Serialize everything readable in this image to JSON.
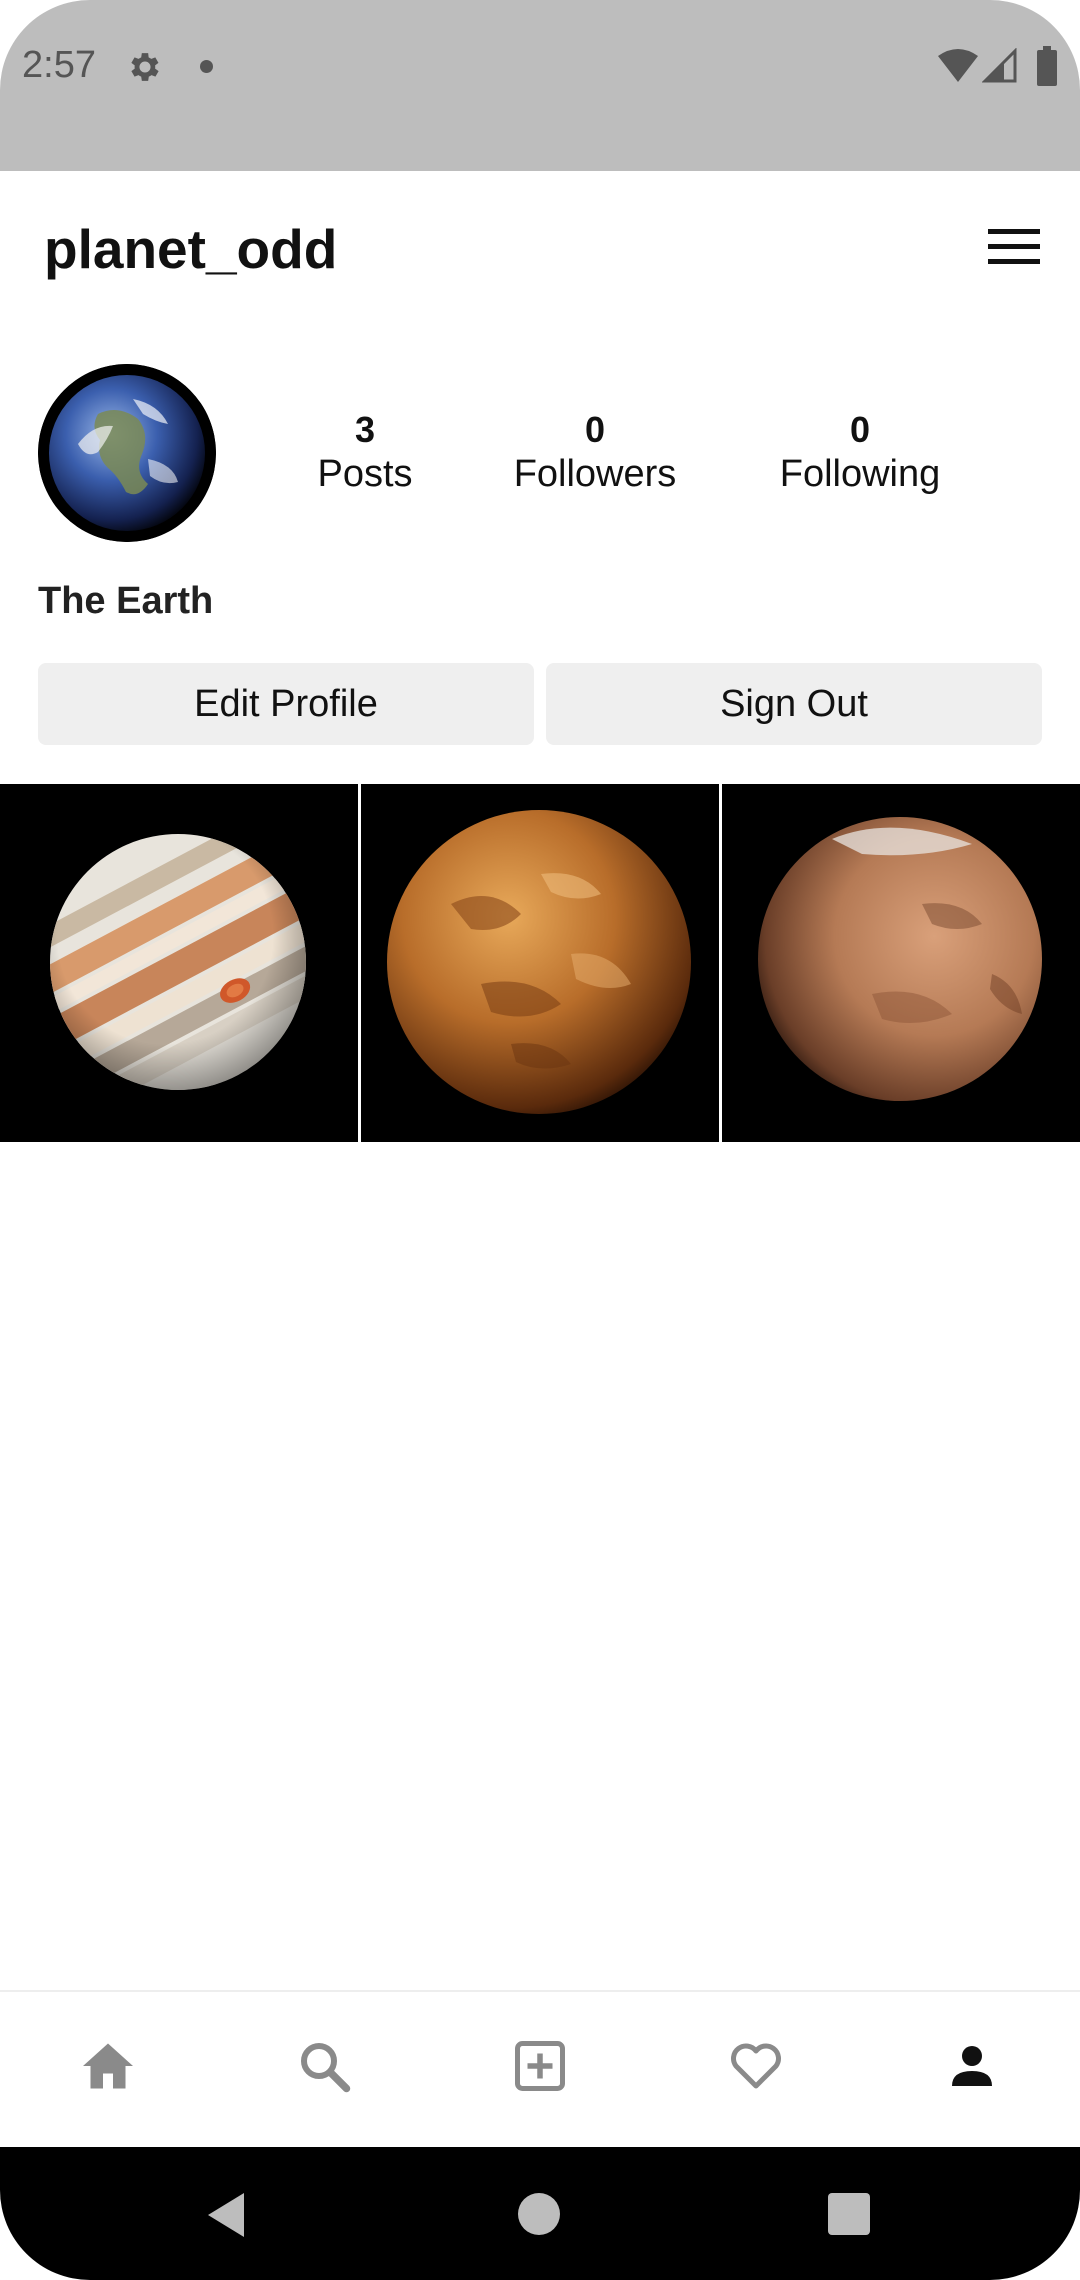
{
  "status_bar": {
    "time": "2:57",
    "icons": [
      "gear-icon",
      "notification-dot-icon",
      "wifi-icon",
      "cell-signal-icon",
      "battery-icon"
    ]
  },
  "header": {
    "username": "planet_odd",
    "menu_icon": "hamburger-menu-icon"
  },
  "profile": {
    "avatar_icon": "earth-avatar",
    "stats": {
      "posts": {
        "count": "3",
        "label": "Posts"
      },
      "followers": {
        "count": "0",
        "label": "Followers"
      },
      "following": {
        "count": "0",
        "label": "Following"
      }
    },
    "display_name": "The Earth",
    "buttons": {
      "edit_profile": "Edit Profile",
      "sign_out": "Sign Out"
    }
  },
  "posts": [
    {
      "subject": "jupiter"
    },
    {
      "subject": "venus"
    },
    {
      "subject": "mars"
    }
  ],
  "bottom_nav": {
    "items": [
      "home-icon",
      "search-icon",
      "add-post-icon",
      "heart-icon",
      "profile-icon"
    ],
    "active": "profile-icon"
  },
  "system_nav": {
    "items": [
      "back-icon",
      "home-circle-icon",
      "recents-icon"
    ]
  },
  "colors": {
    "status_bar": "#bdbdbd",
    "button_bg": "#efefef",
    "inactive_icon": "#8a8a8a",
    "active_icon": "#111111"
  }
}
